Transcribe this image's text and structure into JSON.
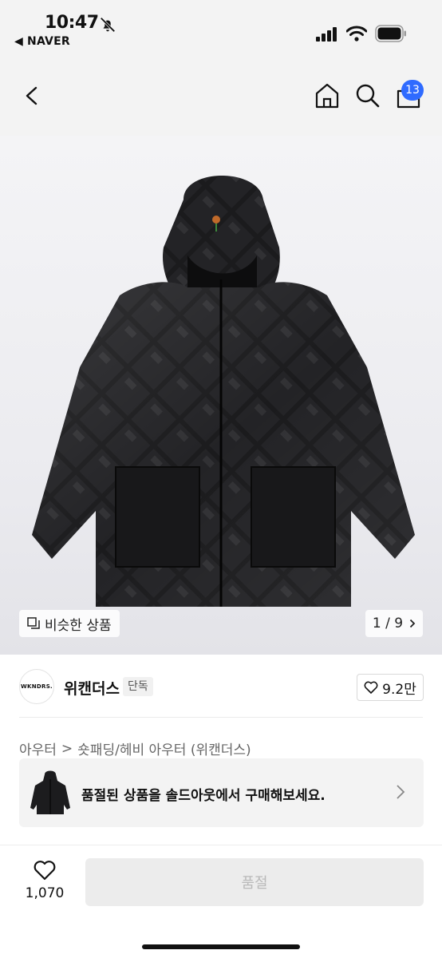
{
  "status_bar": {
    "time": "10:47",
    "back_app": "◀ NAVER"
  },
  "nav": {
    "cart_count": "13"
  },
  "gallery": {
    "similar_label": "비슷한 상품",
    "page_indicator": "1 / 9"
  },
  "brand": {
    "logo_text": "WKNDRS.",
    "name": "위캔더스",
    "tag": "단독",
    "likes": "9.2만"
  },
  "breadcrumb": {
    "level1": "아우터",
    "separator": ">",
    "level2": "숏패딩/헤비 아우터 (위캔더스)"
  },
  "soldout_banner": {
    "message": "품절된 상품을 솔드아웃에서 구매해보세요."
  },
  "bottom": {
    "wish_count": "1,070",
    "button_label": "품절"
  },
  "colors": {
    "badge": "#2f6bff",
    "disabled_button": "#ececec",
    "disabled_text": "#b9b9b9"
  }
}
